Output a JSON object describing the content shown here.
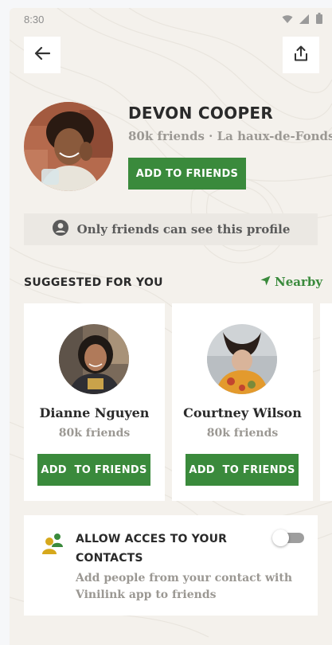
{
  "status_bar": {
    "time": "8:30",
    "wifi_icon": "wifi-icon",
    "signal_icon": "signal-icon",
    "battery_icon": "battery-icon"
  },
  "header": {
    "back_icon": "arrow-left-icon",
    "share_icon": "share-icon"
  },
  "profile": {
    "name": "DEVON COOPER",
    "meta": "80k friends · La haux-de-Fonds",
    "add_label": "ADD TO FRIENDS"
  },
  "privacy": {
    "icon": "user-circle-icon",
    "text": "Only friends can see this profile"
  },
  "suggested": {
    "title": "SUGGESTED FOR YOU",
    "nearby_label": "Nearby",
    "nearby_icon": "navigation-arrow-icon",
    "cards": [
      {
        "name": "Dianne Nguyen",
        "friends": "80k friends",
        "add_label": "ADD  TO FRIENDS"
      },
      {
        "name": "Courtney Wilson",
        "friends": "80k friends",
        "add_label": "ADD  TO FRIENDS"
      }
    ]
  },
  "contacts": {
    "icon": "people-icon",
    "title": "ALLOW ACCES TO YOUR CONTACTS",
    "description": "Add people from your contact with Vinilink app to friends",
    "toggle_on": false
  },
  "colors": {
    "accent": "#3a8a3c",
    "background": "#f4f1ec",
    "muted_text": "#9b9893",
    "people_icon_yellow": "#d6a81c"
  }
}
